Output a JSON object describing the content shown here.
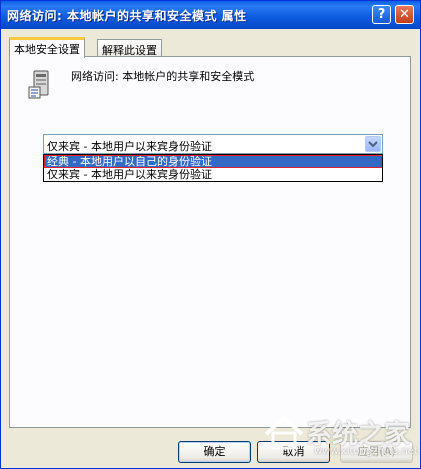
{
  "window": {
    "title": "网络访问: 本地帐户的共享和安全模式 属性",
    "help_glyph": "?",
    "close_glyph": "✕"
  },
  "tabs": [
    {
      "label": "本地安全设置",
      "active": true
    },
    {
      "label": "解释此设置",
      "active": false
    }
  ],
  "policy": {
    "icon": "policy-server-icon",
    "title": "网络访问: 本地帐户的共享和安全模式"
  },
  "combo": {
    "value": "仅来宾 - 本地用户以来宾身份验证",
    "options": [
      {
        "label": "经典 - 本地用户以自己的身份验证",
        "selected": true
      },
      {
        "label": "仅来宾 - 本地用户以来宾身份验证",
        "selected": false
      }
    ]
  },
  "buttons": {
    "ok": "确定",
    "cancel": "取消",
    "apply": "应用(A)"
  },
  "watermark": {
    "text": "系统之家",
    "url": "www.xitongzhijia.net"
  },
  "colors": {
    "titlebar": "#0a5fe6",
    "selection": "#316ac5",
    "highlight_border": "#e0202a",
    "window_bg": "#ece9d8"
  }
}
